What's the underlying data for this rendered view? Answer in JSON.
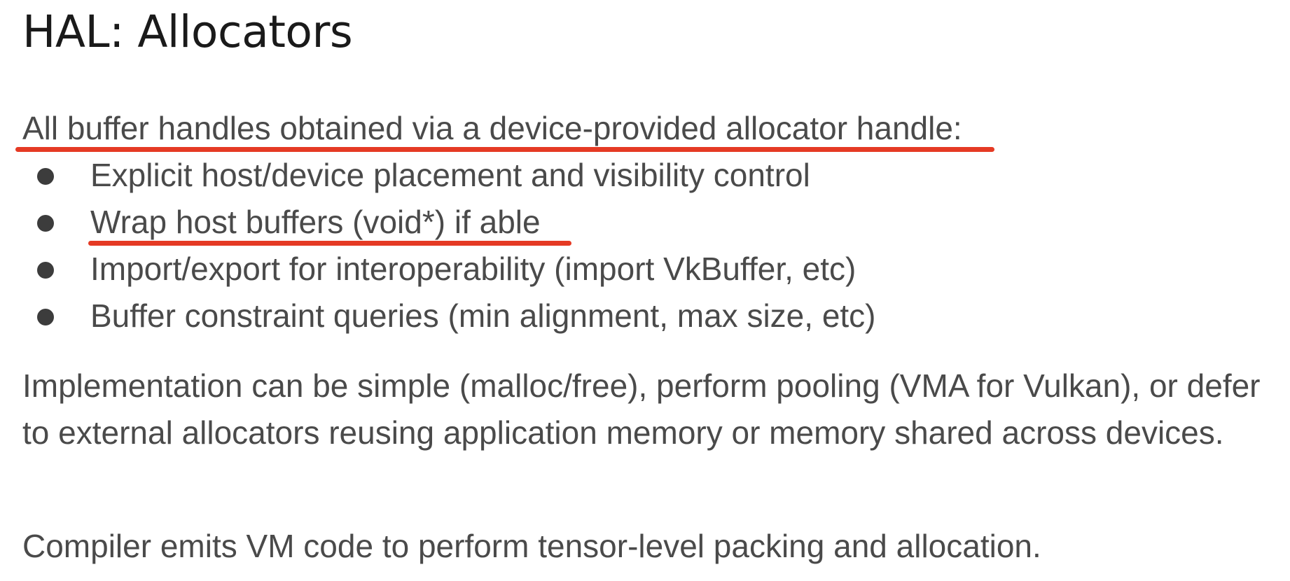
{
  "slide": {
    "title": "HAL: Allocators",
    "intro": "All buffer handles obtained via a device-provided allocator handle:",
    "bullets": [
      {
        "text": "Explicit host/device placement and visibility control"
      },
      {
        "text": "Wrap host buffers (void*) if able"
      },
      {
        "text": "Import/export for interoperability (import VkBuffer, etc)"
      },
      {
        "text": "Buffer constraint queries (min alignment, max size, etc)"
      }
    ],
    "implementation": "Implementation can be simple (malloc/free), perform pooling (VMA for Vulkan), or defer to external allocators reusing application memory or memory shared across devices.",
    "compiler": "Compiler emits VM code to perform tensor-level packing and allocation."
  },
  "colors": {
    "annotation_underline": "#e53a24",
    "body_text": "#4a4a4a",
    "title_text": "#1a1a1a"
  }
}
